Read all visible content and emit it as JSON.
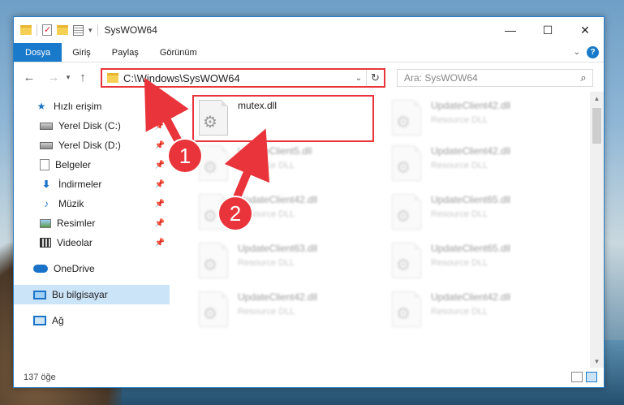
{
  "window": {
    "title": "SysWOW64",
    "controls": {
      "minimize": "—",
      "maximize": "☐",
      "close": "✕"
    }
  },
  "ribbon": {
    "tabs": [
      "Dosya",
      "Giriş",
      "Paylaş",
      "Görünüm"
    ]
  },
  "address": {
    "path": "C:\\Windows\\SysWOW64",
    "search_placeholder": "Ara: SysWOW64"
  },
  "sidebar": {
    "items": [
      {
        "label": "Hızlı erişim",
        "icon": "star-icon"
      },
      {
        "label": "Yerel Disk (C:)",
        "icon": "drive-icon",
        "pinned": true
      },
      {
        "label": "Yerel Disk (D:)",
        "icon": "drive-icon",
        "pinned": true
      },
      {
        "label": "Belgeler",
        "icon": "document-icon",
        "pinned": true
      },
      {
        "label": "İndirmeler",
        "icon": "download-icon",
        "pinned": true
      },
      {
        "label": "Müzik",
        "icon": "music-icon",
        "pinned": true
      },
      {
        "label": "Resimler",
        "icon": "pictures-icon",
        "pinned": true
      },
      {
        "label": "Videolar",
        "icon": "videos-icon",
        "pinned": true
      },
      {
        "label": "OneDrive",
        "icon": "cloud-icon"
      },
      {
        "label": "Bu bilgisayar",
        "icon": "computer-icon",
        "selected": true
      },
      {
        "label": "Ağ",
        "icon": "network-icon"
      }
    ]
  },
  "files": [
    {
      "name": "mutex.dll",
      "type": ""
    },
    {
      "name": "UpdateClient42.dll",
      "type": "Resource DLL"
    },
    {
      "name": "UpdateClient5.dll",
      "type": "Resource DLL"
    },
    {
      "name": "UpdateClient42.dll",
      "type": "Resource DLL"
    },
    {
      "name": "UpdateClient42.dll",
      "type": "Resource DLL"
    },
    {
      "name": "UpdateClient65.dll",
      "type": "Resource DLL"
    },
    {
      "name": "UpdateClient63.dll",
      "type": "Resource DLL"
    },
    {
      "name": "UpdateClient65.dll",
      "type": "Resource DLL"
    },
    {
      "name": "UpdateClient42.dll",
      "type": "Resource DLL"
    },
    {
      "name": "UpdateClient42.dll",
      "type": "Resource DLL"
    }
  ],
  "status": {
    "count": "137 öğe"
  },
  "callouts": [
    "1",
    "2"
  ],
  "colors": {
    "accent": "#1979ca",
    "annotation": "#e8343a"
  }
}
